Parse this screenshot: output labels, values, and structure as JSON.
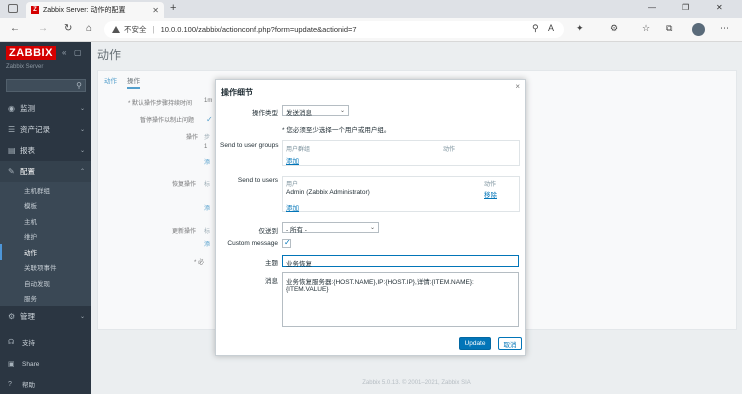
{
  "browser": {
    "tab_title": "Zabbix Server: 动作的配置",
    "tab_favicon_letter": "Z",
    "insecure_label": "不安全",
    "url": "10.0.0.100/zabbix/actionconf.php?form=update&actionid=7"
  },
  "sidebar": {
    "logo": "ZABBIX",
    "server_name": "Zabbix Server",
    "menu": [
      {
        "label": "监测",
        "icon": "eye-icon"
      },
      {
        "label": "资产记录",
        "icon": "list-icon"
      },
      {
        "label": "报表",
        "icon": "chart-icon"
      },
      {
        "label": "配置",
        "icon": "wrench-icon"
      }
    ],
    "submenu": [
      "主机群组",
      "模板",
      "主机",
      "维护",
      "动作",
      "关联项事件",
      "自动发现",
      "服务"
    ],
    "admin": "管理",
    "bottom": [
      "支持",
      "Share",
      "帮助"
    ]
  },
  "main": {
    "title": "动作",
    "tabs": [
      "动作",
      "操作"
    ],
    "bg_labels": [
      "* 默认操作步骤持续时间",
      "暂停操作以制止问题",
      "操作",
      "恢复操作",
      "更新操作"
    ],
    "bg_fragments": [
      "1m",
      "步",
      "1",
      "添",
      "标",
      "添",
      "标",
      "添",
      "* 必"
    ],
    "footer": "Zabbix 5.0.13. © 2001–2021, Zabbix SIA"
  },
  "modal": {
    "title": "操作细节",
    "op_type_label": "操作类型",
    "op_type_value": "发送消息",
    "required_note": "* 您必须至少选择一个用户或用户组。",
    "groups_label": "Send to user groups",
    "groups_col_group": "用户群组",
    "groups_col_action": "动作",
    "groups_add": "添加",
    "users_label": "Send to users",
    "users_col_user": "用户",
    "users_col_action": "动作",
    "user_row": "Admin (Zabbix Administrator)",
    "user_remove": "移除",
    "users_add": "添加",
    "send_only_label": "仅送到",
    "send_only_value": "- 所有 -",
    "custom_msg_label": "Custom message",
    "custom_msg_checked": true,
    "subject_label": "主题",
    "subject_value": "业务恢复",
    "message_label": "消息",
    "message_value": "业务恢复服务器:{HOST.NAME},IP:{HOST.IP},详情:{ITEM.NAME}:{ITEM.VALUE}",
    "update_btn": "Update",
    "cancel_btn": "取消"
  },
  "colors": {
    "sidebar_bg": "#2b3642",
    "accent": "#0275b8",
    "logo_red": "#d40000"
  }
}
